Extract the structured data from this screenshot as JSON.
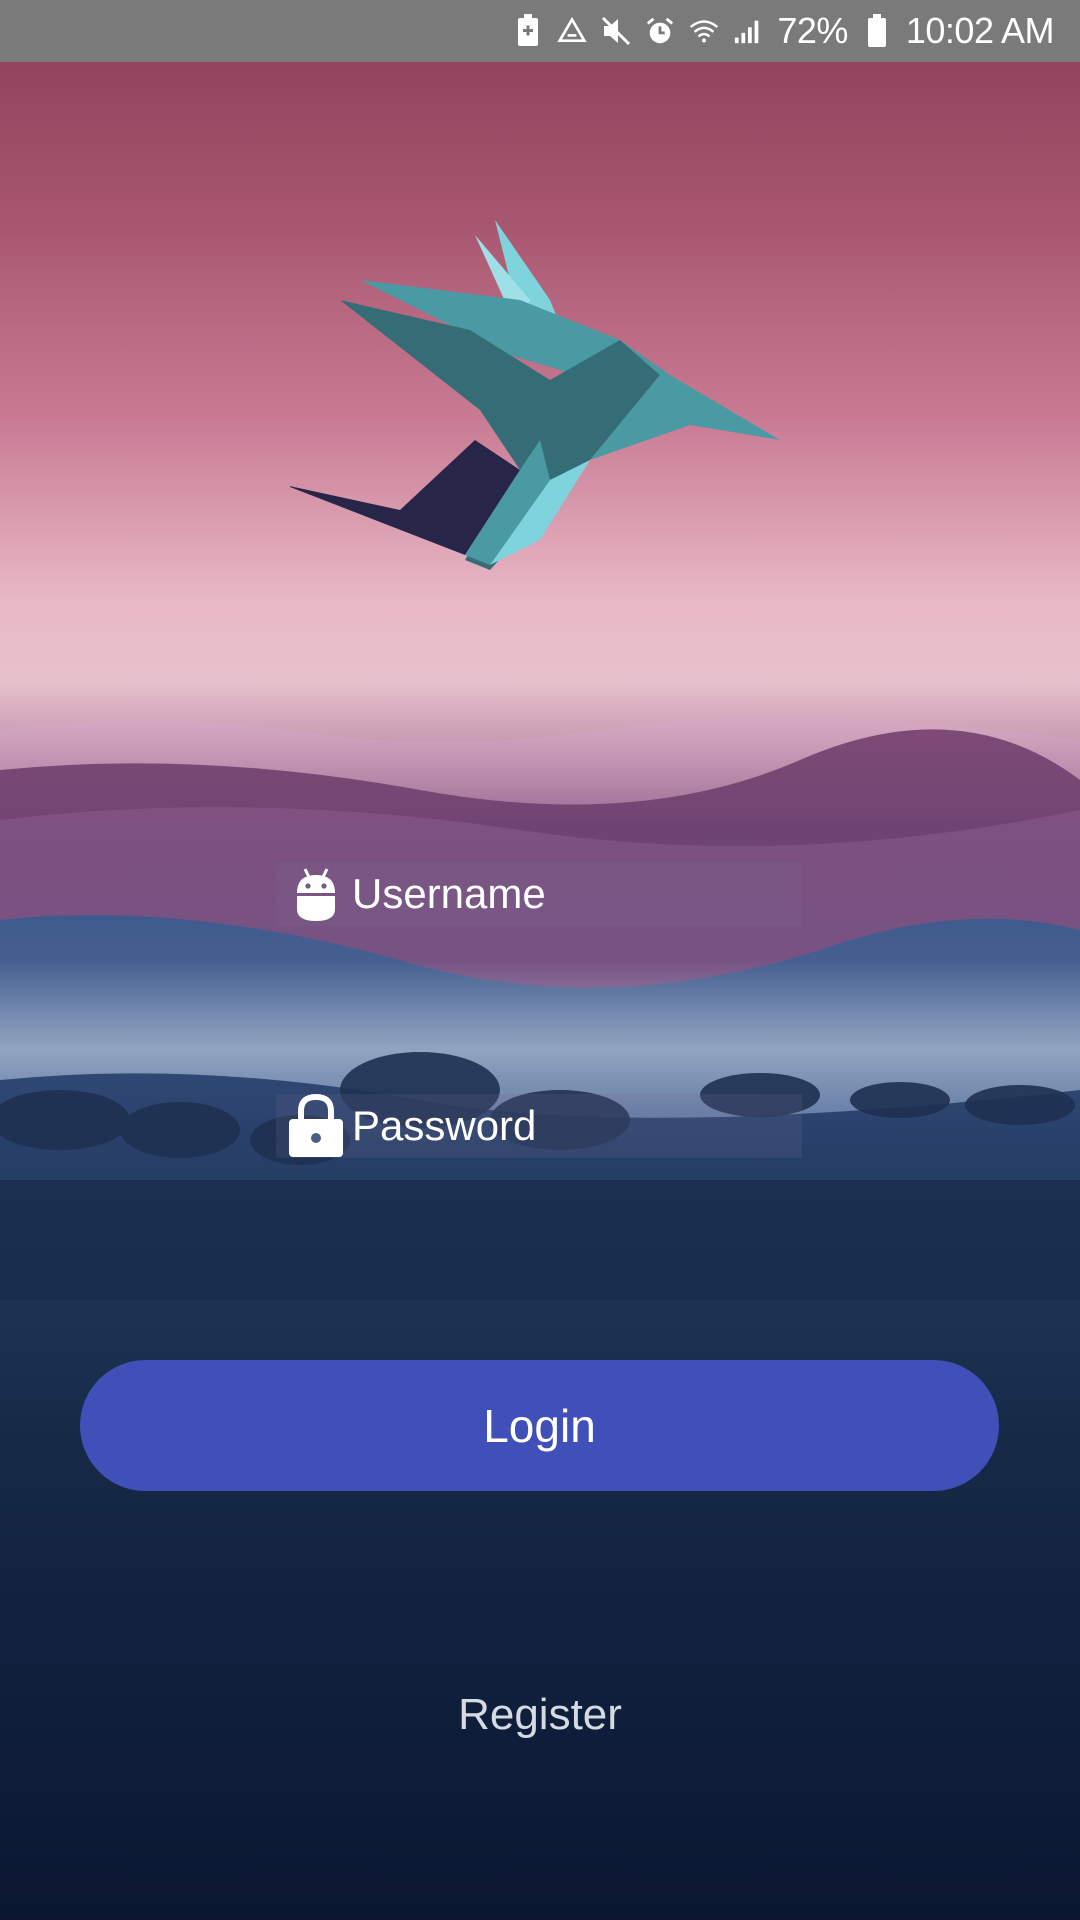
{
  "status_bar": {
    "battery_percent": "72%",
    "time": "10:02 AM",
    "icons": [
      "battery-saver-icon",
      "recycle-icon",
      "mute-icon",
      "alarm-icon",
      "wifi-icon",
      "signal-icon",
      "battery-icon"
    ]
  },
  "app": {
    "logo_icon": "bird-logo-icon",
    "colors": {
      "logo_light": "#7fd3dc",
      "logo_mid": "#4a9aa3",
      "logo_dark": "#356d77",
      "logo_navy": "#272548",
      "button": "#4150b8"
    }
  },
  "login_form": {
    "username": {
      "icon": "android-icon",
      "placeholder": "Username",
      "value": ""
    },
    "password": {
      "icon": "lock-icon",
      "placeholder": "Password",
      "value": ""
    },
    "login_label": "Login",
    "register_label": "Register"
  }
}
